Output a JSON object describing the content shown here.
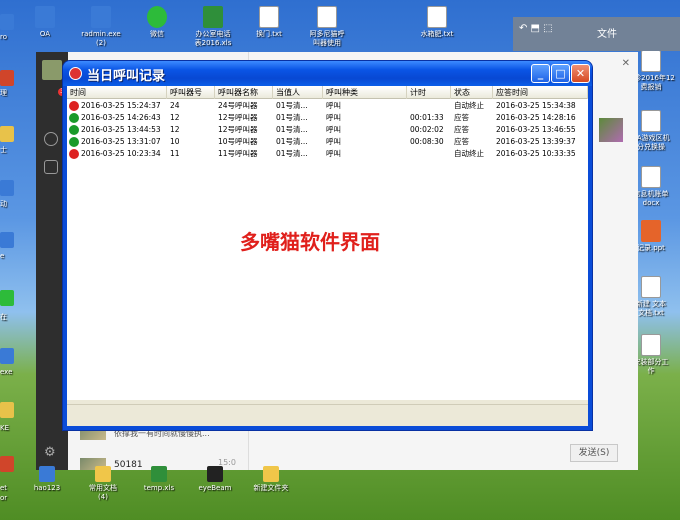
{
  "desktop": {
    "top_icons": [
      {
        "label": "OA",
        "kind": "app"
      },
      {
        "label": "radmin.exe\n(2)",
        "kind": "app"
      },
      {
        "label": "微信",
        "kind": "wechat"
      },
      {
        "label": "办公室电话\n表2016.xls",
        "kind": "xls"
      },
      {
        "label": "换门.txt",
        "kind": "doc"
      },
      {
        "label": "阿多尼猫呼\n叫器使用",
        "kind": "doc"
      },
      {
        "label": "水箱肥.txt",
        "kind": "doc"
      }
    ],
    "left_labels": [
      "ro",
      "理",
      "士",
      "动",
      "e",
      "在",
      "exe",
      "KE",
      "et",
      "or"
    ],
    "right_icons": [
      {
        "label": "门诊2016年12\n费报销",
        "kind": "doc"
      },
      {
        "label": "4A游戏区机\n分兑换操",
        "kind": "doc"
      },
      {
        "label": "信息机账单\ndocx",
        "kind": "doc"
      },
      {
        "label": "记录.ppt",
        "kind": "ppt"
      },
      {
        "label": "新建 文本\n文档.txt",
        "kind": "doc"
      },
      {
        "label": "安装部分工\n作",
        "kind": "doc"
      }
    ],
    "bottom_icons": [
      {
        "label": "hao123",
        "kind": "app"
      },
      {
        "label": "常用文档\n(4)",
        "kind": "folder"
      },
      {
        "label": "temp.xls",
        "kind": "xls"
      },
      {
        "label": "eyeBeam",
        "kind": "app"
      },
      {
        "label": "新建文件夹",
        "kind": "folder"
      }
    ]
  },
  "chat_app": {
    "badge_count": "3",
    "chat_preview_text": "依撑我一有时间就慢慢执...",
    "chat_item_time": "15:0",
    "chat_item_number": "50181",
    "send_button_label": "发送(S)",
    "explorer_title": "文件"
  },
  "dialog": {
    "title": "当日呼叫记录",
    "watermark_text": "多嘴猫软件界面",
    "columns": [
      "时间",
      "呼叫器号",
      "呼叫器名称",
      "当值人",
      "呼叫种类",
      "计时",
      "状态",
      "应答时间"
    ],
    "rows": [
      {
        "icon": "missed",
        "time": "2016-03-25 15:24:37",
        "caller_no": "24",
        "caller_name": "24号呼叫器",
        "on_duty": "01号清...",
        "call_type": "呼叫",
        "duration": "",
        "status": "自动终止",
        "answer_time": "2016-03-25 15:34:38"
      },
      {
        "icon": "answered",
        "time": "2016-03-25 14:26:43",
        "caller_no": "12",
        "caller_name": "12号呼叫器",
        "on_duty": "01号清...",
        "call_type": "呼叫",
        "duration": "00:01:33",
        "status": "应答",
        "answer_time": "2016-03-25 14:28:16"
      },
      {
        "icon": "answered",
        "time": "2016-03-25 13:44:53",
        "caller_no": "12",
        "caller_name": "12号呼叫器",
        "on_duty": "01号清...",
        "call_type": "呼叫",
        "duration": "00:02:02",
        "status": "应答",
        "answer_time": "2016-03-25 13:46:55"
      },
      {
        "icon": "answered",
        "time": "2016-03-25 13:31:07",
        "caller_no": "10",
        "caller_name": "10号呼叫器",
        "on_duty": "01号清...",
        "call_type": "呼叫",
        "duration": "00:08:30",
        "status": "应答",
        "answer_time": "2016-03-25 13:39:37"
      },
      {
        "icon": "missed",
        "time": "2016-03-25 10:23:34",
        "caller_no": "11",
        "caller_name": "11号呼叫器",
        "on_duty": "01号清...",
        "call_type": "呼叫",
        "duration": "",
        "status": "自动终止",
        "answer_time": "2016-03-25 10:33:35"
      }
    ]
  }
}
